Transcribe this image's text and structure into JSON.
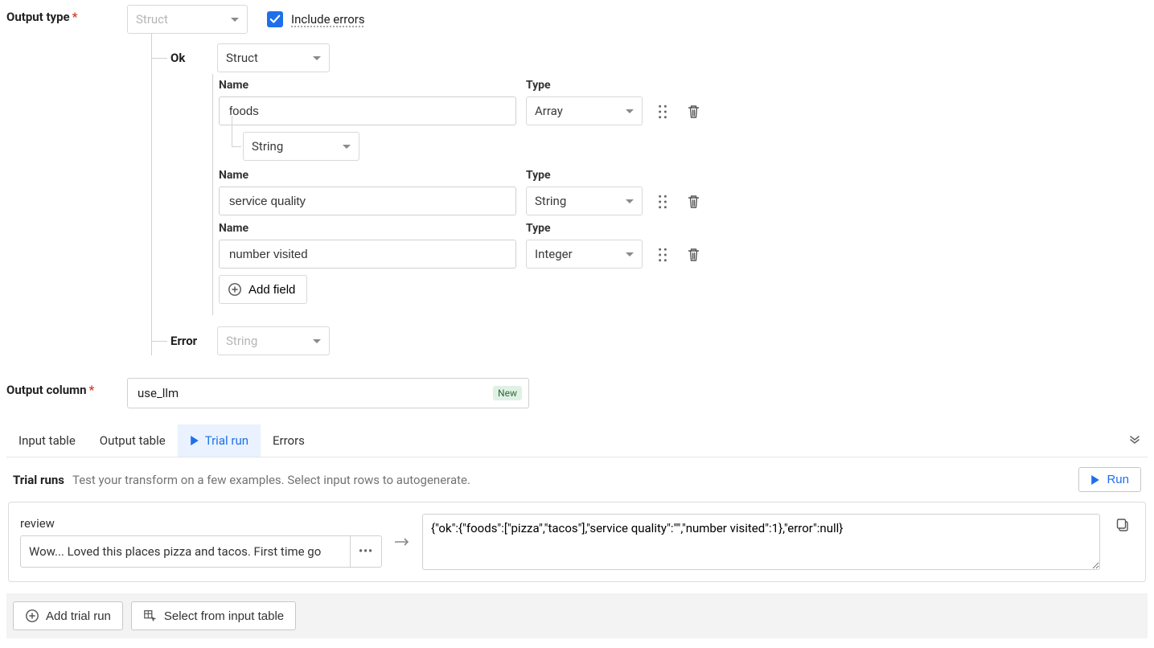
{
  "output_type": {
    "label": "Output type",
    "select_value": "Struct",
    "include_errors_label": "Include errors",
    "include_errors_checked": true
  },
  "ok_branch": {
    "label": "Ok",
    "select_value": "Struct",
    "fields": [
      {
        "name_header": "Name",
        "type_header": "Type",
        "name": "foods",
        "type": "Array",
        "subtype": "String"
      },
      {
        "name_header": "Name",
        "type_header": "Type",
        "name": "service quality",
        "type": "String"
      },
      {
        "name_header": "Name",
        "type_header": "Type",
        "name": "number visited",
        "type": "Integer"
      }
    ],
    "add_field_label": "Add field"
  },
  "error_branch": {
    "label": "Error",
    "select_value": "String"
  },
  "output_column": {
    "label": "Output column",
    "value": "use_llm",
    "badge": "New"
  },
  "tabs": {
    "input_table": "Input table",
    "output_table": "Output table",
    "trial_run": "Trial run",
    "errors": "Errors"
  },
  "trial": {
    "header_title": "Trial runs",
    "header_subtitle": "Test your transform on a few examples. Select input rows to autogenerate.",
    "run_label": "Run",
    "review_label": "review",
    "review_value": "Wow... Loved this places pizza and tacos. First time go",
    "output_json": "{\"ok\":{\"foods\":[\"pizza\",\"tacos\"],\"service quality\":\"\",\"number visited\":1},\"error\":null}"
  },
  "bottom": {
    "add_trial_run": "Add trial run",
    "select_from_input": "Select from input table"
  }
}
